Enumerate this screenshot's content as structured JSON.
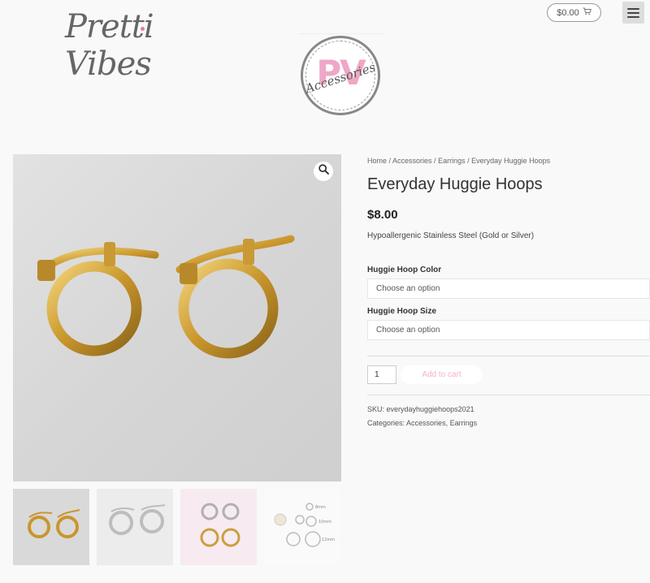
{
  "header": {
    "logo_text": "Pretti Vibes",
    "badge_big": "PV",
    "badge_script": "Accessories",
    "cart_amount": "$0.00"
  },
  "breadcrumb": {
    "home": "Home",
    "sep": " / ",
    "accessories": "Accessories",
    "earrings": "Earrings",
    "current": "Everyday Huggie Hoops"
  },
  "product": {
    "title": "Everyday Huggie Hoops",
    "price": "$8.00",
    "description": "Hypoallergenic Stainless Steel (Gold or Silver)",
    "color_label": "Huggie Hoop Color",
    "color_value": "Choose an option",
    "size_label": "Huggie Hoop Size",
    "size_value": "Choose an option",
    "quantity": "1",
    "add_to_cart": "Add to cart",
    "sku_label": "SKU:",
    "sku": "everydayhuggiehoops2021",
    "categories_label": "Categories:",
    "category_1": "Accessories",
    "category_2": "Earrings"
  },
  "thumb_labels": {
    "s1": "8mm",
    "s2": "10mm",
    "s3": "12mm"
  },
  "colors": {
    "brand_pink": "#e87aa5",
    "add_to_cart_text": "#f3b1cf",
    "gold": "#d4a93c",
    "silver": "#c8c8c8"
  }
}
